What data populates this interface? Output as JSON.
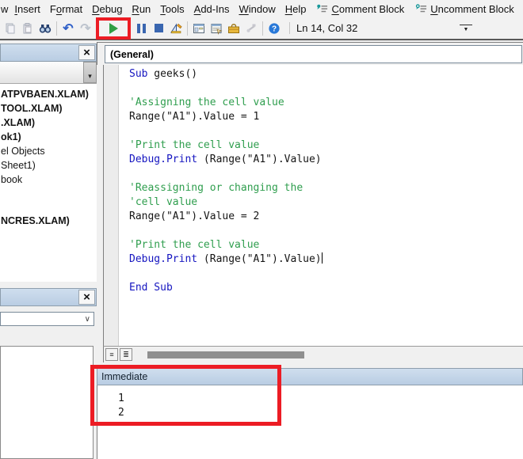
{
  "colors": {
    "keyword_blue": "#1515c0",
    "comment_green": "#2f9e4e",
    "highlight_red": "#ec1c24",
    "run_green": "#2f9e44",
    "debug_blue": "#3a66b0",
    "panel_header_top": "#cfdeee",
    "panel_header_bottom": "#b9cde3"
  },
  "menu": {
    "partial_item": "w",
    "items": [
      {
        "label": "Insert",
        "u": 0
      },
      {
        "label": "Format",
        "u": 1
      },
      {
        "label": "Debug",
        "u": 0
      },
      {
        "label": "Run",
        "u": 0
      },
      {
        "label": "Tools",
        "u": 0
      },
      {
        "label": "Add-Ins",
        "u": 0
      },
      {
        "label": "Window",
        "u": 0
      },
      {
        "label": "Help",
        "u": 0
      }
    ],
    "toolbar_buttons": [
      {
        "label": "Comment Block",
        "u": 0,
        "icon": "comment-block-icon"
      },
      {
        "label": "Uncomment Block",
        "u": 0,
        "icon": "uncomment-block-icon"
      }
    ]
  },
  "toolbar": {
    "status": "Ln 14, Col 32",
    "icons": [
      {
        "name": "copy-icon",
        "disabled": true
      },
      {
        "name": "paste-icon",
        "disabled": true
      },
      {
        "name": "find-icon"
      },
      {
        "name": "separator"
      },
      {
        "name": "undo-icon"
      },
      {
        "name": "redo-icon",
        "disabled": true
      },
      {
        "name": "run-button",
        "boxed": true
      },
      {
        "name": "break-button"
      },
      {
        "name": "reset-button"
      },
      {
        "name": "design-mode-button"
      },
      {
        "name": "separator"
      },
      {
        "name": "project-explorer-button"
      },
      {
        "name": "properties-window-button"
      },
      {
        "name": "object-browser-button"
      },
      {
        "name": "toolbox-button",
        "disabled": true
      },
      {
        "name": "separator"
      },
      {
        "name": "help-button"
      }
    ]
  },
  "project_explorer": {
    "items": [
      {
        "label": "ATPVBAEN.XLAM)",
        "bold": true
      },
      {
        "label": "TOOL.XLAM)",
        "bold": true
      },
      {
        "label": ".XLAM)",
        "bold": true
      },
      {
        "label": "ok1)",
        "bold": true
      },
      {
        "label": "el Objects",
        "bold": false
      },
      {
        "label": "Sheet1)",
        "bold": false
      },
      {
        "label": "book",
        "bold": false
      },
      {
        "label": "NCRES.XLAM)",
        "bold": true
      }
    ]
  },
  "code_window": {
    "object_dropdown": "(General)",
    "lines": [
      [
        {
          "t": "Sub",
          "c": "kw"
        },
        {
          "t": " geeks()",
          "c": "tx"
        }
      ],
      [],
      [
        {
          "t": "'Assigning the cell value",
          "c": "cm"
        }
      ],
      [
        {
          "t": "Range(\"A1\").Value = 1",
          "c": "tx"
        }
      ],
      [],
      [
        {
          "t": "'Print the cell value",
          "c": "cm"
        }
      ],
      [
        {
          "t": "Debug.Print",
          "c": "kw"
        },
        {
          "t": " (Range(\"A1\").Value)",
          "c": "tx"
        }
      ],
      [],
      [
        {
          "t": "'Reassigning or changing the",
          "c": "cm"
        }
      ],
      [
        {
          "t": "'cell value",
          "c": "cm"
        }
      ],
      [
        {
          "t": "Range(\"A1\").Value = 2",
          "c": "tx"
        }
      ],
      [],
      [
        {
          "t": "'Print the cell value",
          "c": "cm"
        }
      ],
      [
        {
          "t": "Debug.Print",
          "c": "kw"
        },
        {
          "t": " (Range(\"A1\").Value)",
          "c": "tx"
        },
        {
          "t": "",
          "c": "cursor"
        }
      ],
      [],
      [
        {
          "t": "End Sub",
          "c": "kw"
        }
      ]
    ]
  },
  "immediate_window": {
    "title": "Immediate",
    "lines": [
      "1",
      "2"
    ]
  }
}
